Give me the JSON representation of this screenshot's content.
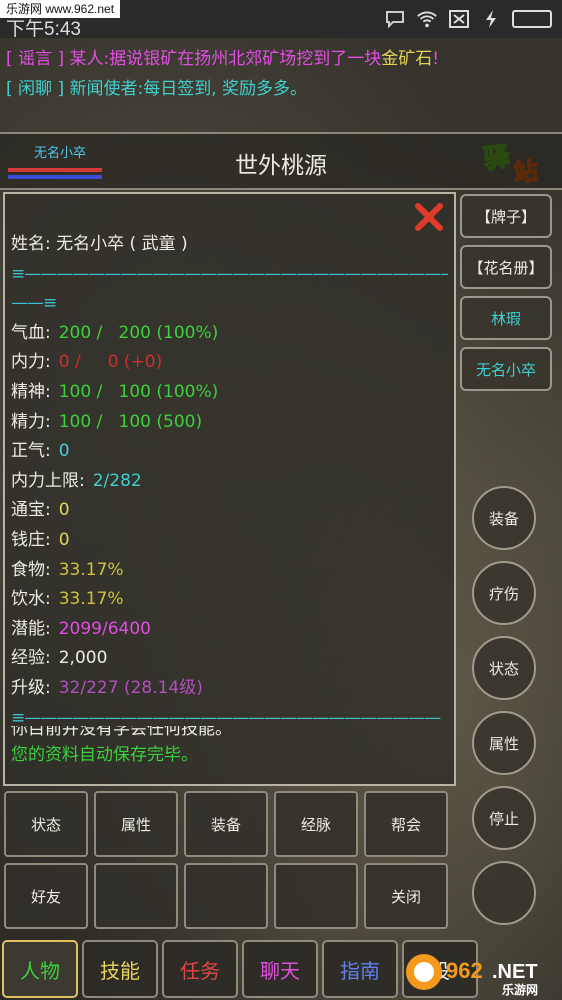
{
  "status_bar": {
    "watermark": "乐游网 www.962.net",
    "time": "下午5:43"
  },
  "messages": {
    "line1": {
      "tag": "[ 谣言 ]",
      "speaker": "某人:",
      "text": "据说银矿在扬州北郊矿场挖到了一块",
      "highlight": "金矿石",
      "tail": "!"
    },
    "line2": {
      "tag": "[ 闲聊 ]",
      "speaker": "新闻使者:",
      "text": "每日签到, 奖励多多。"
    }
  },
  "title_bar": {
    "player_name": "无名小卒",
    "location": "世外桃源",
    "station_logo": "驿站"
  },
  "profile": {
    "name_row": "姓名: 无名小卒 ( 武童 )",
    "divider_top": "≡———————————————————————————",
    "divider_top2": "——≡",
    "stats": [
      {
        "label": "气血:",
        "value": "200 /   200 (100%)",
        "color": "green"
      },
      {
        "label": "内力:",
        "value": "0 /     0 (+0)",
        "color": "red"
      },
      {
        "label": "精神:",
        "value": "100 /   100 (100%)",
        "color": "green"
      },
      {
        "label": "精力:",
        "value": "100 /   100 (500)",
        "color": "green"
      },
      {
        "label": "正气:",
        "value": "0",
        "color": "cyan"
      },
      {
        "label": "内力上限:",
        "value": "2/282",
        "color": "cyan"
      },
      {
        "label": "通宝:",
        "value": "0",
        "color": "yellow"
      },
      {
        "label": "钱庄:",
        "value": "0",
        "color": "yellow"
      },
      {
        "label": "食物:",
        "value": "33.17%",
        "color": "olive"
      },
      {
        "label": "饮水:",
        "value": "33.17%",
        "color": "olive"
      },
      {
        "label": "潜能:",
        "value": "2099/6400",
        "color": "magenta"
      },
      {
        "label": "经验:",
        "value": "2,000",
        "color": "white"
      },
      {
        "label": "升级:",
        "value": "32/227 (28.14级)",
        "color": "purple"
      }
    ],
    "divider_bottom": "≡——————————————————————————",
    "skills_msg": "你目前并没有学会任何技能。",
    "save_msg": "您的资料自动保存完毕。"
  },
  "right_buttons": [
    "【牌子】",
    "【花名册】",
    "林瑕",
    "无名小卒"
  ],
  "circle_buttons": [
    "装备",
    "疗伤",
    "状态",
    "属性",
    "停止",
    ""
  ],
  "grid_buttons": [
    "状态",
    "属性",
    "装备",
    "经脉",
    "帮会",
    "好友",
    "",
    "",
    "",
    "关闭"
  ],
  "tabs": [
    {
      "label": "人物",
      "color": "#3bd13b"
    },
    {
      "label": "技能",
      "color": "#e6d45a"
    },
    {
      "label": "任务",
      "color": "#e04545"
    },
    {
      "label": "聊天",
      "color": "#e24ee2"
    },
    {
      "label": "指南",
      "color": "#5f7ff0"
    },
    {
      "label": "设",
      "color": "#ecebe4"
    }
  ],
  "watermark_bottom": {
    "brand": "962.NET",
    "sub": "乐游网"
  },
  "colors": {
    "accent_green": "#3bd13b",
    "accent_cyan": "#3fd0d0",
    "accent_magenta": "#e24ee2",
    "close_red": "#e03a2a"
  }
}
